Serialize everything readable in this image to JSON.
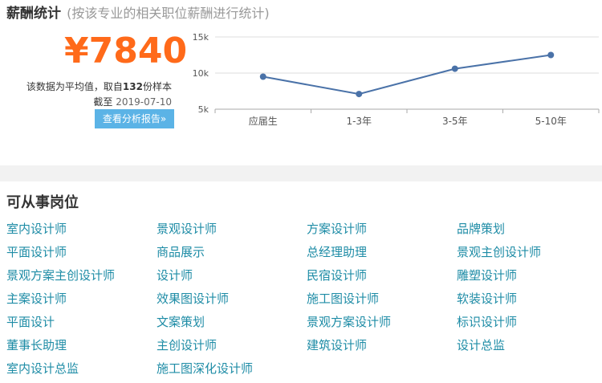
{
  "header": {
    "title": "薪酬统计",
    "subtitle": "(按该专业的相关职位薪酬进行统计)"
  },
  "salary": {
    "amount": "¥7840",
    "note_prefix": "该数据为平均值，取自",
    "sample_count": "132",
    "note_suffix": "份样本",
    "cutoff_label": "截至",
    "cutoff_date": "2019-07-10",
    "report_button": "查看分析报告»"
  },
  "colors": {
    "accent_orange": "#ff6a1a",
    "link_teal": "#1e8ca6",
    "button_blue": "#5bb3e6",
    "line_blue": "#4a72a8"
  },
  "chart_data": {
    "type": "line",
    "categories": [
      "应届生",
      "1-3年",
      "3-5年",
      "5-10年"
    ],
    "values": [
      9500,
      7100,
      10600,
      12500
    ],
    "ylim": [
      5000,
      15000
    ],
    "yticks": [
      5000,
      10000,
      15000
    ],
    "ytick_labels": [
      "5k",
      "10k",
      "15k"
    ],
    "grid": true
  },
  "jobs_section": {
    "title": "可从事岗位",
    "items": [
      "室内设计师",
      "景观设计师",
      "方案设计师",
      "品牌策划",
      "平面设计师",
      "商品展示",
      "总经理助理",
      "景观主创设计师",
      "景观方案主创设计师",
      "设计师",
      "民宿设计师",
      "雕塑设计师",
      "主案设计师",
      "效果图设计师",
      "施工图设计师",
      "软装设计师",
      "平面设计",
      "文案策划",
      "景观方案设计师",
      "标识设计师",
      "董事长助理",
      "主创设计师",
      "建筑设计师",
      "设计总监",
      "室内设计总监",
      "施工图深化设计师"
    ]
  }
}
